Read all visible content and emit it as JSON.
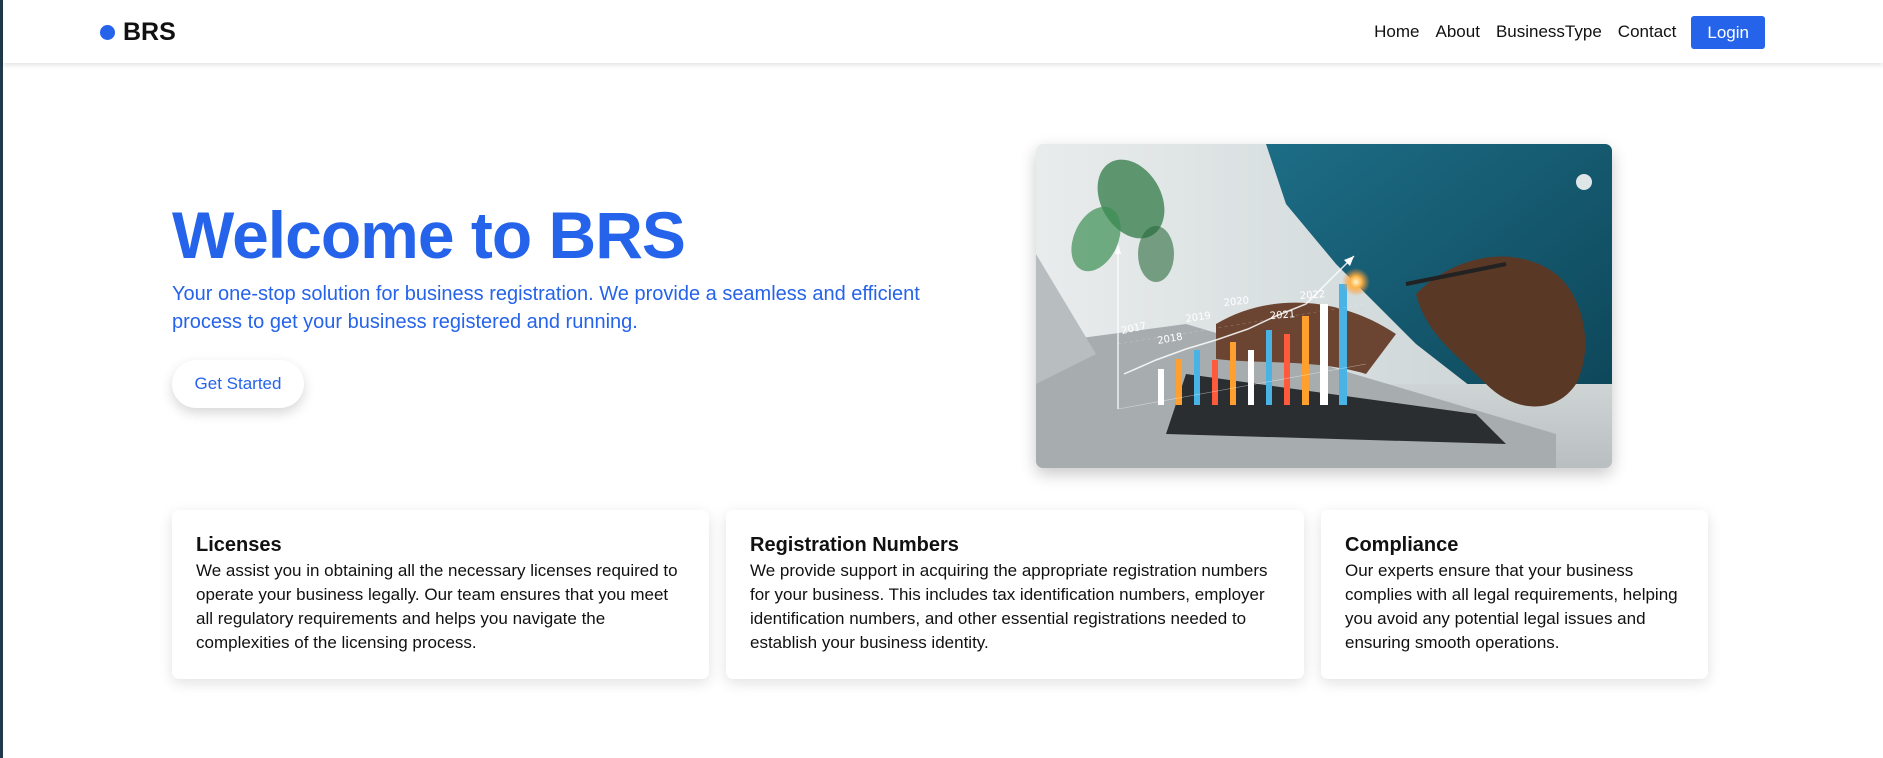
{
  "brand": {
    "name": "BRS"
  },
  "nav": {
    "items": [
      {
        "label": "Home"
      },
      {
        "label": "About"
      },
      {
        "label": "BusinessType"
      },
      {
        "label": "Contact"
      }
    ],
    "login_label": "Login"
  },
  "hero": {
    "title": "Welcome to BRS",
    "subtitle": "Your one-stop solution for business registration. We provide a seamless and efficient process to get your business registered and running.",
    "cta_label": "Get Started",
    "image": {
      "subject": "hand-on-laptop-with-growth-chart",
      "chart_years": [
        "2017",
        "2018",
        "2019",
        "2020",
        "2021",
        "2022"
      ]
    }
  },
  "features": [
    {
      "title": "Licenses",
      "text": "We assist you in obtaining all the necessary licenses required to operate your business legally. Our team ensures that you meet all regulatory requirements and helps you navigate the complexities of the licensing process."
    },
    {
      "title": "Registration Numbers",
      "text": "We provide support in acquiring the appropriate registration numbers for your business. This includes tax identification numbers, employer identification numbers, and other essential registrations needed to establish your business identity."
    },
    {
      "title": "Compliance",
      "text": "Our experts ensure that your business complies with all legal requirements, helping you avoid any potential legal issues and ensuring smooth operations."
    }
  ],
  "colors": {
    "accent": "#2563eb",
    "text": "#111111",
    "background": "#ffffff",
    "left_edge": "#1f3a4a"
  }
}
